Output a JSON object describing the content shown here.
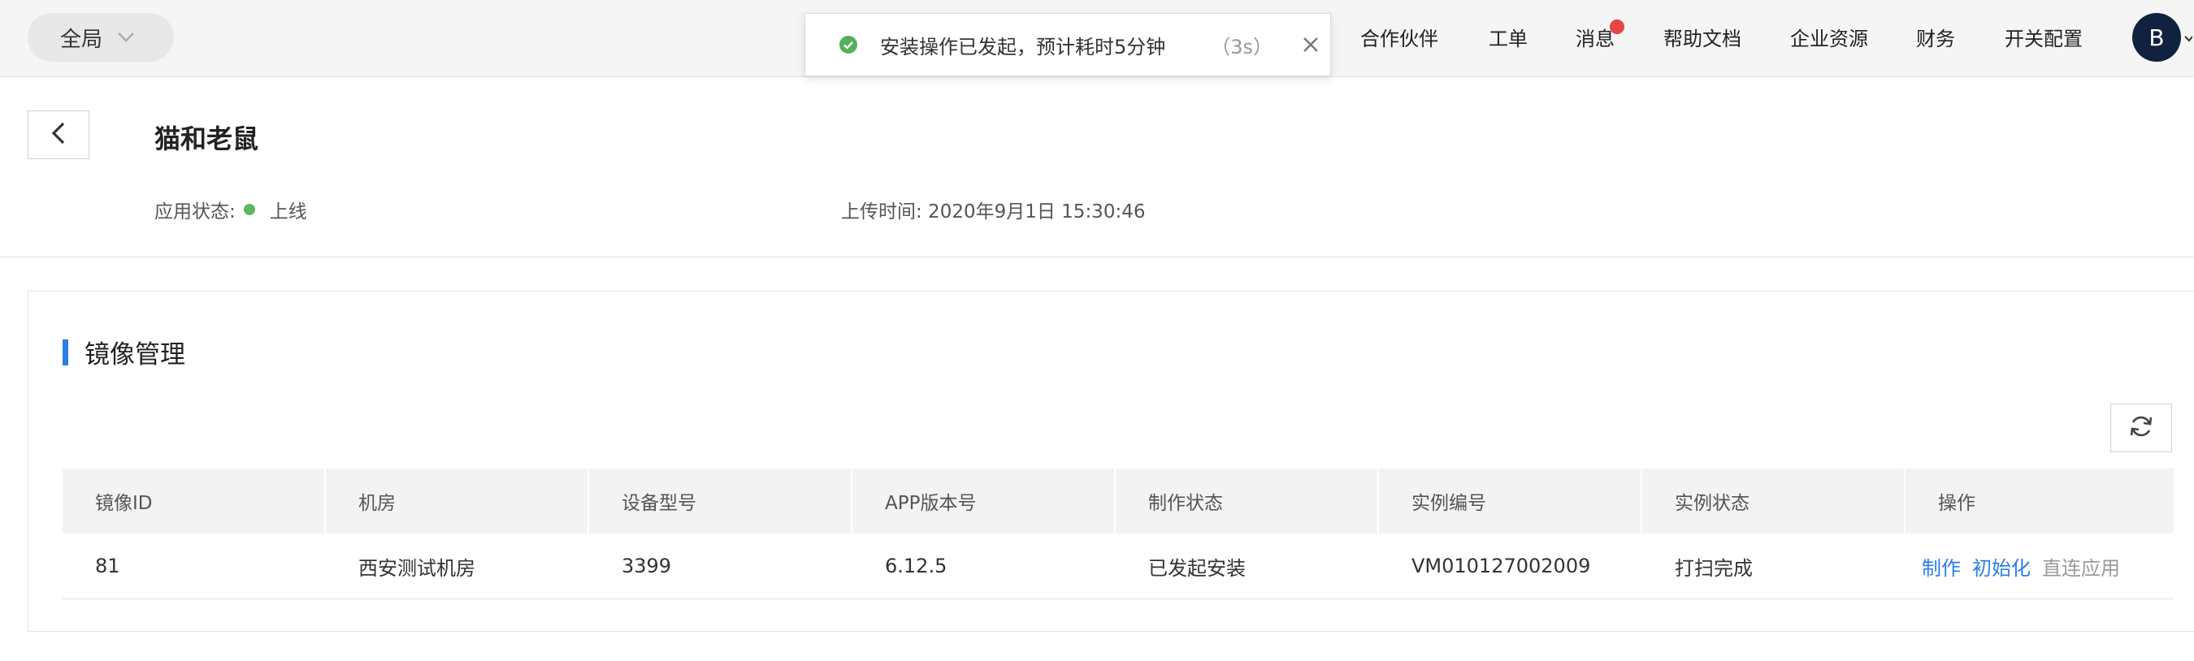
{
  "header": {
    "scope_label": "全局",
    "nav_items": [
      "合作伙伴",
      "工单",
      "消息",
      "帮助文档",
      "企业资源",
      "财务",
      "开关配置"
    ],
    "avatar_letter": "B"
  },
  "toast": {
    "message": "安装操作已发起，预计耗时5分钟",
    "countdown": "（3s）"
  },
  "app": {
    "title": "猫和老鼠",
    "status_label": "应用状态:",
    "status_value": "上线",
    "upload_time": "上传时间: 2020年9月1日 15:30:46"
  },
  "image_mgmt": {
    "title": "镜像管理",
    "columns": [
      "镜像ID",
      "机房",
      "设备型号",
      "APP版本号",
      "制作状态",
      "实例编号",
      "实例状态",
      "操作"
    ],
    "rows": [
      {
        "id": "81",
        "room": "西安测试机房",
        "device": "3399",
        "app_version": "6.12.5",
        "make_status": "已发起安装",
        "instance_no": "VM010127002009",
        "instance_status": "打扫完成",
        "actions": [
          "制作",
          "初始化",
          "直连应用"
        ]
      }
    ]
  },
  "colors": {
    "accent": "#2b7ce9",
    "status_online": "#5cb85c",
    "badge": "#e54545",
    "avatar": "#102240"
  }
}
